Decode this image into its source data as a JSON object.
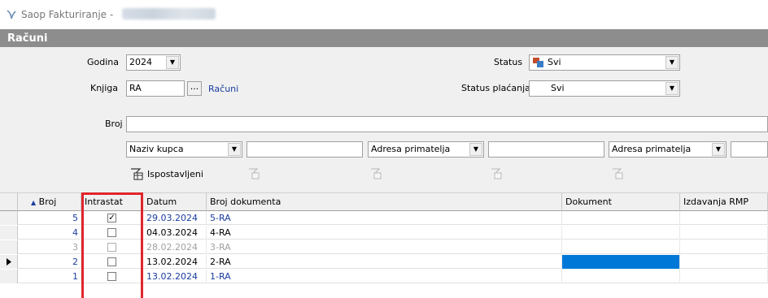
{
  "window": {
    "app_title": "Saop Fakturiranje -",
    "panel_title": "Računi"
  },
  "filters": {
    "godina_label": "Godina",
    "godina_value": "2024",
    "knjiga_label": "Knjiga",
    "knjiga_value": "RA",
    "knjiga_browse": "...",
    "knjiga_link": "Računi",
    "status_label": "Status",
    "status_value": "Svi",
    "status_placanja_label": "Status plaćanja",
    "status_placanja_value": "Svi",
    "broj_label": "Broj",
    "broj_value": "",
    "search_col1": "Naziv kupca",
    "search_col2": "Adresa primatelja",
    "search_col3": "Adresa primatelja",
    "ispostavljeni_label": "Ispostavljeni"
  },
  "table": {
    "columns": [
      "Broj",
      "Intrastat",
      "Datum",
      "Broj dokumenta",
      "Dokument",
      "Izdavanja RMP"
    ],
    "sort_indicator": "▲",
    "rows": [
      {
        "broj": "5",
        "intrastat": true,
        "datum": "29.03.2024",
        "broj_dokumenta": "5-RA",
        "style": "blue",
        "selected": false
      },
      {
        "broj": "4",
        "intrastat": false,
        "datum": "04.03.2024",
        "broj_dokumenta": "4-RA",
        "style": "normal",
        "selected": false
      },
      {
        "broj": "3",
        "intrastat": false,
        "datum": "28.02.2024",
        "broj_dokumenta": "3-RA",
        "style": "gray",
        "selected": false
      },
      {
        "broj": "2",
        "intrastat": false,
        "datum": "13.02.2024",
        "broj_dokumenta": "2-RA",
        "style": "normal",
        "selected": true
      },
      {
        "broj": "1",
        "intrastat": false,
        "datum": "13.02.2024",
        "broj_dokumenta": "1-RA",
        "style": "blue",
        "selected": false
      }
    ]
  },
  "colors": {
    "accent_blue": "#0078d7",
    "link_blue": "#1a3ca0",
    "highlight_red": "#e0252d",
    "header_band": "#8d8d8d"
  }
}
